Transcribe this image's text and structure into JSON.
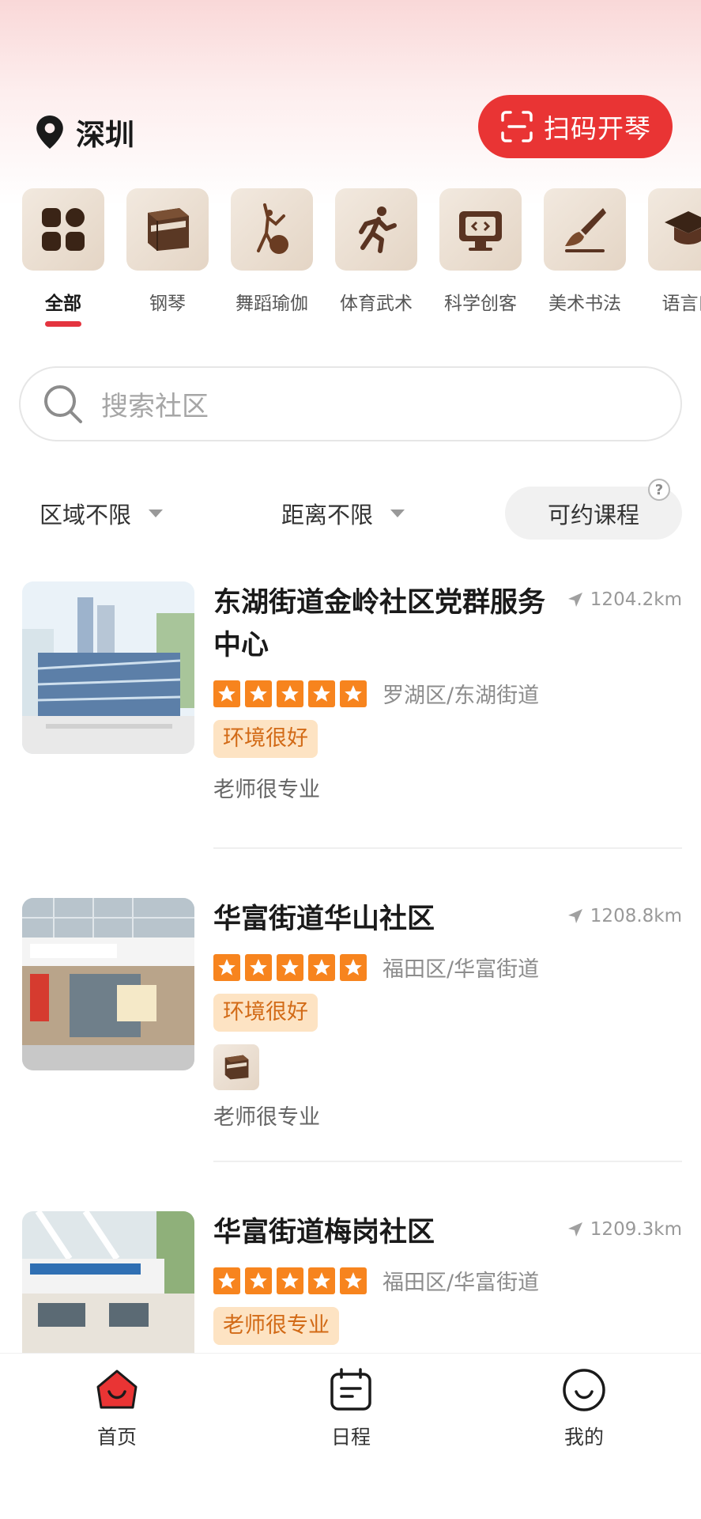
{
  "header": {
    "city": "深圳",
    "scan_button": "扫码开琴",
    "pin_icon": "location-pin-icon",
    "scan_icon": "scan-icon"
  },
  "categories": [
    {
      "label": "全部",
      "icon": "grid-icon",
      "active": true
    },
    {
      "label": "钢琴",
      "icon": "piano-icon",
      "active": false
    },
    {
      "label": "舞蹈瑜伽",
      "icon": "dance-icon",
      "active": false
    },
    {
      "label": "体育武术",
      "icon": "running-icon",
      "active": false
    },
    {
      "label": "科学创客",
      "icon": "monitor-icon",
      "active": false
    },
    {
      "label": "美术书法",
      "icon": "brush-icon",
      "active": false
    },
    {
      "label": "语言口",
      "icon": "graduation-cap-icon",
      "active": false
    }
  ],
  "search": {
    "placeholder": "搜索社区"
  },
  "filters": {
    "region": "区域不限",
    "distance": "距离不限",
    "bookable": "可约课程",
    "help": "?"
  },
  "communities": [
    {
      "title": "东湖街道金岭社区党群服务中心",
      "distance": "1204.2km",
      "rating": 5,
      "region": "罗湖区/东湖街道",
      "tag": "环境很好",
      "comment": "老师很专业"
    },
    {
      "title": "华富街道华山社区",
      "distance": "1208.8km",
      "rating": 5,
      "region": "福田区/华富街道",
      "tag": "环境很好",
      "category_icon": "piano-icon",
      "comment": "老师很专业"
    },
    {
      "title": "华富街道梅岗社区",
      "distance": "1209.3km",
      "rating": 5,
      "region": "福田区/华富街道",
      "tag": "老师很专业"
    }
  ],
  "tabbar": [
    {
      "label": "首页",
      "icon": "home-icon",
      "active": true
    },
    {
      "label": "日程",
      "icon": "calendar-icon",
      "active": false
    },
    {
      "label": "我的",
      "icon": "smiley-profile-icon",
      "active": false
    }
  ],
  "colors": {
    "accent": "#e93434",
    "star": "#f7841e",
    "tag_bg": "#fde3c3",
    "tag_text": "#d26a16"
  }
}
